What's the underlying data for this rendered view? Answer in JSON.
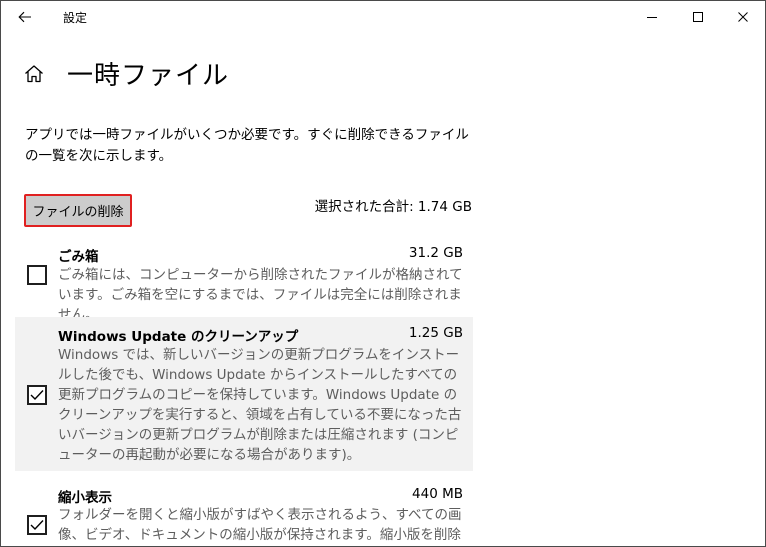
{
  "window": {
    "title": "設定",
    "back_icon": "back-arrow-icon",
    "minimize_icon": "minimize-icon",
    "maximize_icon": "maximize-icon",
    "close_icon": "close-icon"
  },
  "header": {
    "home_icon": "home-icon",
    "title": "一時ファイル"
  },
  "description": "アプリでは一時ファイルがいくつか必要です。すぐに削除できるファイルの一覧を次に示します。",
  "actions": {
    "delete_label": "ファイルの削除",
    "delete_button_border": "#e02020"
  },
  "summary": {
    "total_label": "選択された合計: 1.74 GB"
  },
  "items": [
    {
      "name": "ごみ箱",
      "size": "31.2 GB",
      "checked": false,
      "description": "ごみ箱には、コンピューターから削除されたファイルが格納されています。ごみ箱を空にするまでは、ファイルは完全には削除されません。"
    },
    {
      "name": "Windows Update のクリーンアップ",
      "size": "1.25 GB",
      "checked": true,
      "description": "Windows では、新しいバージョンの更新プログラムをインストールした後でも、Windows Update からインストールしたすべての更新プログラムのコピーを保持しています。Windows Update のクリーンアップを実行すると、領域を占有している不要になった古いバージョンの更新プログラムが削除または圧縮されます (コンピューターの再起動が必要になる場合があります)。"
    },
    {
      "name": "縮小表示",
      "size": "440 MB",
      "checked": true,
      "description": "フォルダーを開くと縮小版がすばやく表示されるよう、すべての画像、ビデオ、ドキュメントの縮小版が保持されます。縮小版を削除すると、必"
    }
  ]
}
